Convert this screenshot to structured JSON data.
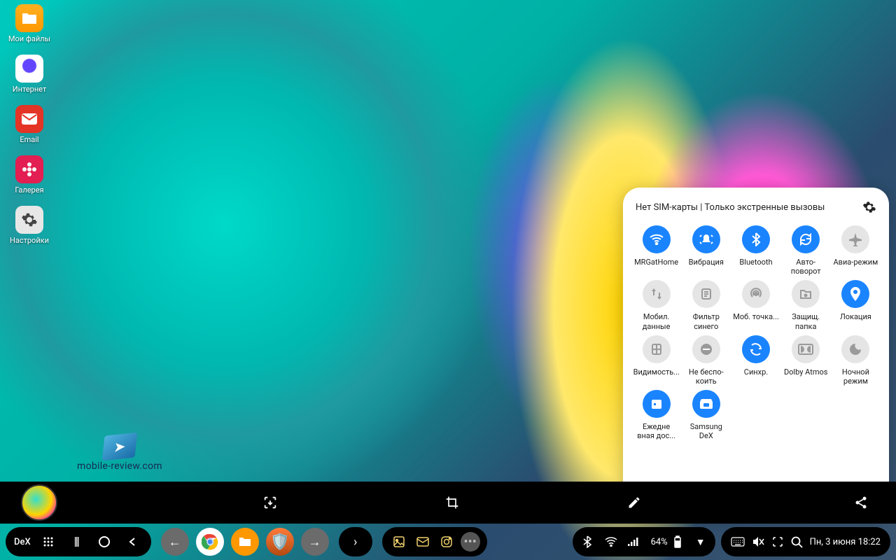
{
  "desktop": {
    "icons": [
      {
        "label": "Мои файлы"
      },
      {
        "label": "Интернет"
      },
      {
        "label": "Email"
      },
      {
        "label": "Галерея"
      },
      {
        "label": "Настройки"
      }
    ]
  },
  "watermark": "mobile-review.com",
  "quick_settings": {
    "status_text": "Нет SIM-карты | Только экстренные вызовы",
    "tiles": [
      {
        "label": "MRGatHome",
        "on": true,
        "icon": "wifi"
      },
      {
        "label": "Вибрация",
        "on": true,
        "icon": "vibrate"
      },
      {
        "label": "Bluetooth",
        "on": true,
        "icon": "bluetooth"
      },
      {
        "label": "Авто-поворот",
        "on": true,
        "icon": "rotate"
      },
      {
        "label": "Авиа-режим",
        "on": false,
        "icon": "airplane"
      },
      {
        "label": "Мобил. данные",
        "on": false,
        "icon": "data"
      },
      {
        "label": "Фильтр синего",
        "on": false,
        "icon": "bluefilter"
      },
      {
        "label": "Моб. точка...",
        "on": false,
        "icon": "hotspot"
      },
      {
        "label": "Защищ. папка",
        "on": false,
        "icon": "secure"
      },
      {
        "label": "Локация",
        "on": true,
        "icon": "location"
      },
      {
        "label": "Видимость...",
        "on": false,
        "icon": "visibility"
      },
      {
        "label": "Не беспо-коить",
        "on": false,
        "icon": "dnd"
      },
      {
        "label": "Синхр.",
        "on": true,
        "icon": "sync"
      },
      {
        "label": "Dolby Atmos",
        "on": false,
        "icon": "dolby"
      },
      {
        "label": "Ночной режим",
        "on": false,
        "icon": "night"
      },
      {
        "label": "Ежедне вная дос...",
        "on": true,
        "icon": "daily"
      },
      {
        "label": "Samsung DeX",
        "on": true,
        "icon": "dex"
      }
    ]
  },
  "taskbar": {
    "dex_label": "DeX",
    "battery_text": "64%",
    "datetime": "Пн, 3 июня 18:22"
  }
}
